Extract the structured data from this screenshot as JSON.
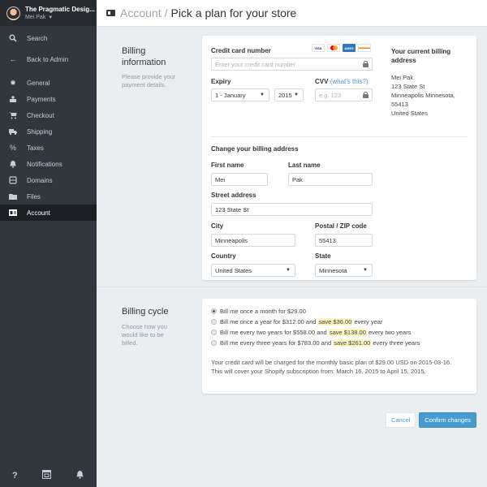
{
  "sidebar": {
    "store_name": "The Pragmatic Desig...",
    "user_name": "Mei Pak",
    "top_items": [
      {
        "label": "Search",
        "icon": "search-icon"
      },
      {
        "label": "Back to Admin",
        "icon": "arrow-left-icon"
      }
    ],
    "items": [
      {
        "label": "General",
        "icon": "gear-icon"
      },
      {
        "label": "Payments",
        "icon": "payments-icon"
      },
      {
        "label": "Checkout",
        "icon": "cart-icon"
      },
      {
        "label": "Shipping",
        "icon": "truck-icon"
      },
      {
        "label": "Taxes",
        "icon": "percent-icon"
      },
      {
        "label": "Notifications",
        "icon": "bell-icon"
      },
      {
        "label": "Domains",
        "icon": "domains-icon"
      },
      {
        "label": "Files",
        "icon": "folder-icon"
      },
      {
        "label": "Account",
        "icon": "account-card-icon",
        "active": true
      }
    ],
    "footer_icons": [
      "help-icon",
      "calendar-icon",
      "bell-icon"
    ],
    "footer_help": "?"
  },
  "header": {
    "breadcrumb": "Account",
    "separator": "/",
    "title": "Pick a plan for your store"
  },
  "billing": {
    "title": "Billing information",
    "description": "Please provide your payment details.",
    "card_number_label": "Credit card number",
    "card_number_placeholder": "Enter your credit card number",
    "card_brands": [
      "VISA",
      "MasterCard",
      "AMEX",
      "Discover"
    ],
    "expiry_label": "Expiry",
    "expiry_month": "1 - January",
    "expiry_year": "2015",
    "cvv_label": "CVV",
    "cvv_link": "(what's this?)",
    "cvv_placeholder": "e.g. 123",
    "current_address_title": "Your current billing address",
    "current_address": [
      "Mei Pak",
      "123 State St",
      "Minneapolis Minnesota,",
      "55413",
      "United States"
    ],
    "change_address_title": "Change your billing address",
    "first_name_label": "First name",
    "first_name": "Mei",
    "last_name_label": "Last name",
    "last_name": "Pak",
    "street_label": "Street address",
    "street": "123 State St",
    "city_label": "City",
    "city": "Minneapolis",
    "zip_label": "Postal / ZIP code",
    "zip": "55413",
    "country_label": "Country",
    "country": "United States",
    "state_label": "State",
    "state": "Minnesota"
  },
  "cycle": {
    "title": "Billing cycle",
    "description": "Choose how you would like to be billed.",
    "options": [
      {
        "pre": "Bill me once a month for $29.00",
        "save": "",
        "post": "",
        "checked": true
      },
      {
        "pre": "Bill me once a year for $312.00 and ",
        "save": "save $36.00",
        "post": " every year",
        "checked": false
      },
      {
        "pre": "Bill me every two years for $558.00 and ",
        "save": "save $138.00",
        "post": " every two years",
        "checked": false
      },
      {
        "pre": "Bill me every three years for $783.00 and ",
        "save": "save $261.00",
        "post": " every three years",
        "checked": false
      }
    ],
    "note_line1": "Your credit card will be charged for the monthly basic plan of $29.00 USD on 2015-03-16.",
    "note_line2": "This will cover your Shopify subscription from: March 16, 2015 to April 15, 2015."
  },
  "actions": {
    "cancel": "Cancel",
    "confirm": "Confirm changes"
  },
  "colors": {
    "accent": "#479ccf",
    "sidebar_bg": "#31373d",
    "highlight": "#fdf5bf"
  }
}
